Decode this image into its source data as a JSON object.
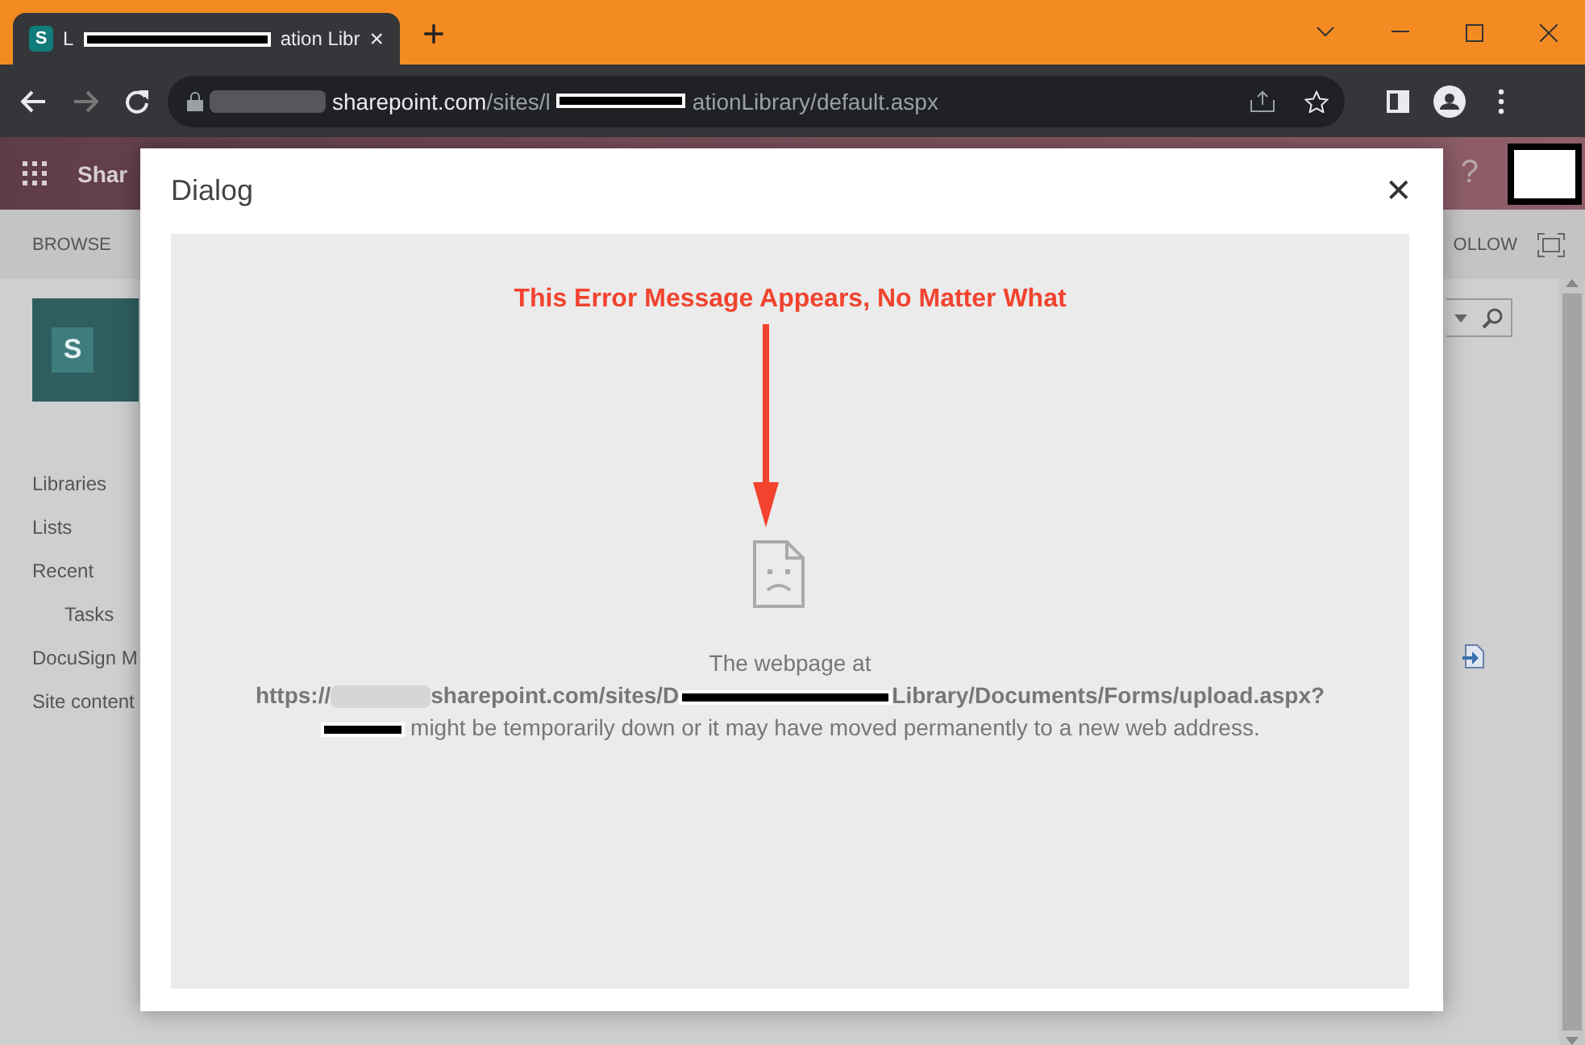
{
  "browser": {
    "tabs": [
      {
        "icon": "S",
        "title_start": "L",
        "title_end": "ation Libr",
        "close": "×",
        "selected": true
      }
    ],
    "new_tab": "+",
    "address": {
      "host": "sharepoint.com",
      "path_start": "/sites/l",
      "path_end": "ationLibrary/default.aspx"
    }
  },
  "suite_bar": {
    "title": "Shar",
    "help": "?"
  },
  "ribbon": {
    "tab": "BROWSE",
    "follow": "OLLOW"
  },
  "nav": {
    "logo": "S",
    "items": [
      {
        "label": "Libraries"
      },
      {
        "label": "Lists"
      },
      {
        "label": "Recent",
        "children": [
          {
            "label": "Tasks"
          }
        ]
      },
      {
        "label": "DocuSign M"
      },
      {
        "label": "Site content"
      }
    ]
  },
  "dialog": {
    "title": "Dialog",
    "close": "✕",
    "annotation": "This Error Message Appears, No Matter What",
    "error": {
      "line_1": "The webpage at",
      "url_start": "https://",
      "url_host": "sharepoint.com/sites/D",
      "url_end": "Library/Documents/Forms/upload.aspx?",
      "message": "might be temporarily down or it may have moved permanently to a new web address."
    }
  }
}
